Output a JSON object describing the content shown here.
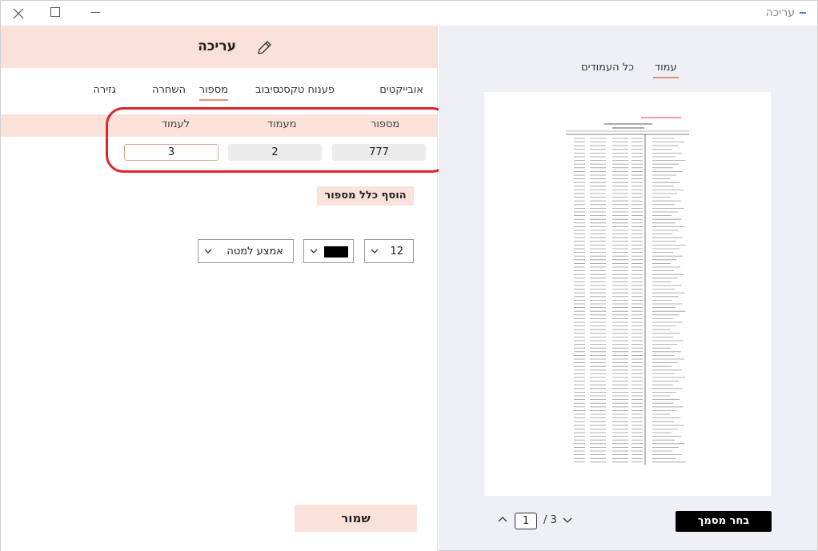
{
  "window": {
    "title": "עריכה",
    "controls": {
      "close": "close-icon",
      "maximize": "maximize-icon",
      "minimize": "minimize-icon"
    }
  },
  "edit_panel": {
    "title": "עריכה",
    "tabs": [
      {
        "label": "אובייקטים",
        "active": false
      },
      {
        "label": "פענוח טקסט",
        "active": false
      },
      {
        "label": "סיבוב",
        "active": false
      },
      {
        "label": "מספור",
        "active": true
      },
      {
        "label": "השחרה",
        "active": false
      },
      {
        "label": "גזירה",
        "active": false
      }
    ],
    "numbering_table": {
      "headers": {
        "number": "מספור",
        "from_page": "מעמוד",
        "to_page": "לעמוד"
      },
      "values": {
        "number": "777",
        "from_page": "2",
        "to_page": "3"
      }
    },
    "add_rule_button": "הוסף כלל מספור",
    "font_size": "12",
    "color_value": "#000000",
    "position": "אמצע למטה",
    "save_button": "שמור"
  },
  "preview_panel": {
    "tabs": [
      {
        "label": "עמוד",
        "active": true
      },
      {
        "label": "כל העמודים",
        "active": false
      }
    ],
    "pager": {
      "current": "1",
      "total": "/ 3"
    },
    "choose_file_button": "בחר מסמך"
  },
  "colors": {
    "accent_pink": "#fae1da",
    "tab_underline": "#e58d7d",
    "highlight_ring": "#e0242b",
    "preview_bg": "#eef0f5"
  }
}
